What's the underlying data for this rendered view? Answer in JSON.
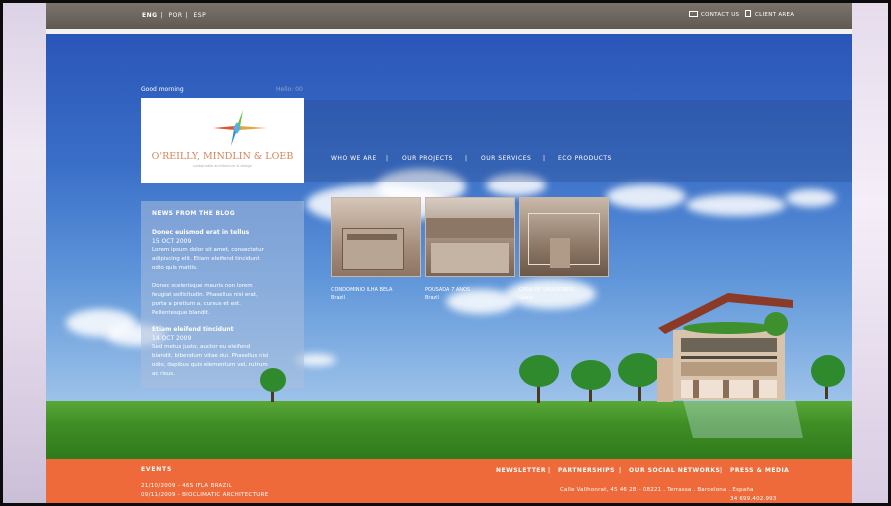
{
  "header": {
    "languages": [
      "ENG",
      "POR",
      "ESP"
    ],
    "contact_label": "CONTACT US",
    "client_area_label": "CLIENT AREA"
  },
  "greeting": {
    "text": "Good morning",
    "hello": "Hello: 00"
  },
  "logo": {
    "name": "O'REILLY, MINDLIN & LOEB",
    "tagline": "sustainable architecture & design"
  },
  "nav": [
    "WHO WE ARE",
    "OUR PROJECTS",
    "OUR SERVICES",
    "ECO PRODUCTS"
  ],
  "blog": {
    "title": "NEWS FROM THE BLOG",
    "posts": [
      {
        "title": "Donec euismod erat in tellus",
        "date": "15 OCT 2009",
        "lines": [
          "Lorem ipsum dolor sit amet, consectetur",
          "adipiscing elit. Etiam eleifend tincidunt",
          "odio quis mattis.",
          "",
          "Donec scelerisque mauris non lorem",
          "feugiat sollicitudin. Phasellus nisi erat,",
          "porta a pretium a, cursus et est.",
          "Pellentesque blandit."
        ]
      },
      {
        "title": "Etiam eleifend tincidunt",
        "date": "14 OCT 2009",
        "lines": [
          "Sed metus justo, auctor eu eleifend",
          "blandit, bibendum vitae dui. Phasellus nisi",
          "odio, dapibus quis elementum vel, rutrum",
          "ac risus."
        ]
      }
    ]
  },
  "projects": [
    {
      "name": "CONDOMINIO ILHA BELA",
      "location": "Brazil"
    },
    {
      "name": "POUSADA 7 ANOS",
      "location": "Brazil"
    },
    {
      "name": "CASA DE VALLDOREIX",
      "location": "Spain"
    }
  ],
  "footer": {
    "events_title": "EVENTS",
    "events": [
      "21/10/2009 - 46S IFLA BRAZIL",
      "09/11/2009 - BIOCLIMATIC ARCHITECTURE"
    ],
    "links": [
      "NEWSLETTER",
      "PARTNERSHIPS",
      "OUR SOCIAL NETWORKS",
      "PRESS & MEDIA"
    ],
    "address": "Calle Vallhonrat, 45  46  2B - 08221 . Terrassa . Barcelona . España",
    "phone": "34 699.402.993"
  },
  "colors": {
    "topbar": "#6b655e",
    "footer": "#ee6a3a",
    "sky": "#3a6fc8",
    "grass": "#3f8e25"
  }
}
